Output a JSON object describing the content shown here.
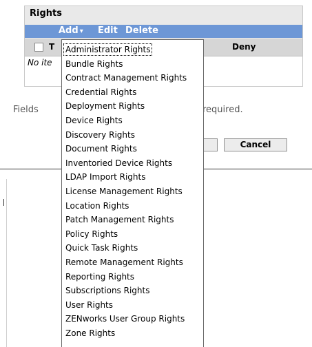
{
  "panel": {
    "title": "Rights",
    "toolbar": {
      "add_label": "Add",
      "add_caret": "▾",
      "edit_label": "Edit",
      "delete_label": "Delete"
    },
    "header": {
      "col_t": "T",
      "col_deny": "Deny"
    },
    "empty_text": "No ite"
  },
  "footer": {
    "fields_left": "Fields",
    "fields_right": "required.",
    "cancel_label": "Cancel"
  },
  "menu": {
    "items": [
      "Administrator Rights",
      "Bundle Rights",
      "Contract Management Rights",
      "Credential Rights",
      "Deployment Rights",
      "Device Rights",
      "Discovery Rights",
      "Document Rights",
      "Inventoried Device Rights",
      "LDAP Import Rights",
      "License Management Rights",
      "Location Rights",
      "Patch Management Rights",
      "Policy Rights",
      "Quick Task Rights",
      "Remote Management Rights",
      "Reporting Rights",
      "Subscriptions Rights",
      "User Rights",
      "ZENworks User Group Rights",
      "Zone Rights"
    ],
    "focused_index": 0
  },
  "colors": {
    "toolbar": "#6d97d6",
    "header": "#d6d6d6",
    "panel": "#e9e9e9"
  }
}
